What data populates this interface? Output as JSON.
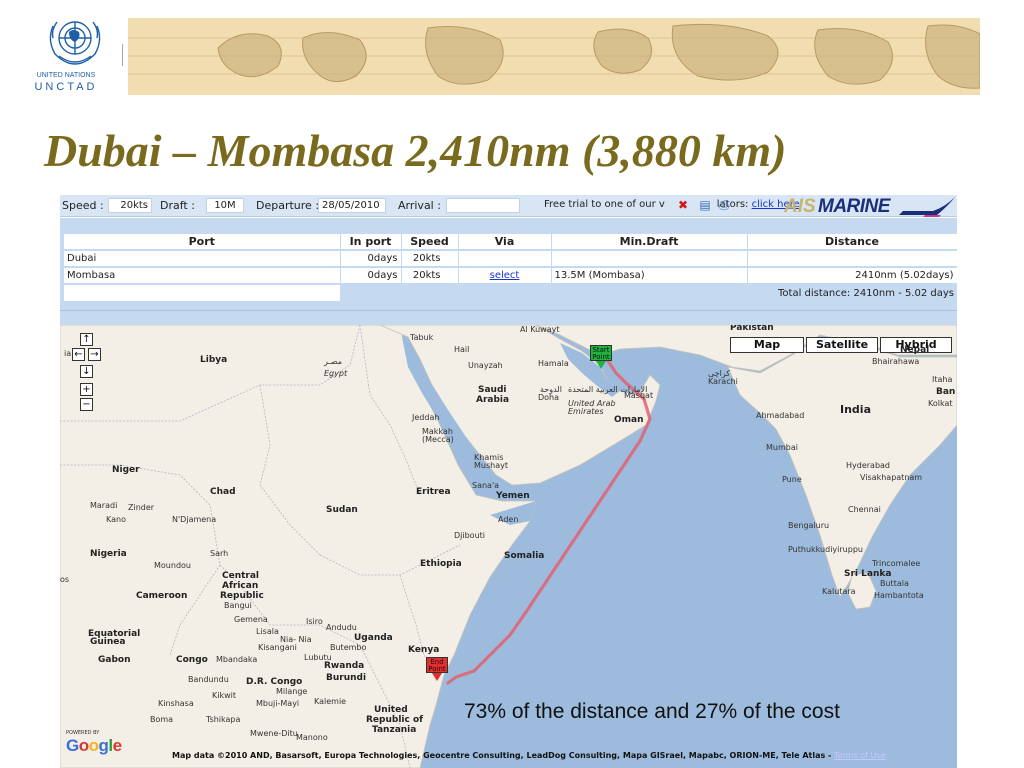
{
  "header": {
    "org_line1": "UNITED NATIONS",
    "org_line2": "UNCTAD"
  },
  "slide": {
    "title": "Dubai – Mombasa 2,410nm (3,880 km)"
  },
  "app": {
    "topbar": {
      "speed_label": "Speed :",
      "speed_value": "20",
      "speed_unit": "kts",
      "draft_label": "Draft :",
      "draft_value": "10M",
      "departure_label": "Departure :",
      "departure_value": "28/05/2010",
      "arrival_label": "Arrival :",
      "arrival_value": "",
      "promo_text": "Free trial to one of our v",
      "promo_text2": "lators:",
      "promo_link": "click here",
      "brand_prefix": "AIS",
      "brand_name": "MARINE"
    },
    "table": {
      "headers": [
        "Port",
        "In port",
        "Speed",
        "Via",
        "Min.Draft",
        "Distance"
      ],
      "rows": [
        {
          "port": "Dubai",
          "in_port_value": "0",
          "in_port_unit": "days",
          "speed_value": "20",
          "speed_unit": "kts",
          "via": "",
          "min_draft": "",
          "distance": ""
        },
        {
          "port": "Mombasa",
          "in_port_value": "0",
          "in_port_unit": "days",
          "speed_value": "20",
          "speed_unit": "kts",
          "via": "select",
          "min_draft": "13.5M (Mombasa)",
          "distance": "2410nm (5.02days)"
        }
      ],
      "total": "Total distance: 2410nm - 5.02 days"
    },
    "map": {
      "type_buttons": [
        "Map",
        "Satellite",
        "Hybrid"
      ],
      "nav_controls": [
        "↑",
        "←",
        "→",
        "↓",
        "+",
        "−"
      ],
      "start_marker": [
        "Start",
        "Point"
      ],
      "end_marker": [
        "End",
        "Point"
      ],
      "caption": "73% of the distance and 27% of the cost",
      "powered_by": "POWERED BY",
      "google": "Google",
      "attribution": "Map data ©2010 AND, Basarsoft, Europa Technologies, Geocentre Consulting, LeadDog Consulting, Mapa GISrael, Mapabc, ORION-ME, Tele Atlas -",
      "terms": "Terms of Use",
      "labels": {
        "libya": "Libya",
        "egypt_ar": "مصـر",
        "egypt": "Egypt",
        "tabuk": "Tabuk",
        "hail": "Hail",
        "unayzah": "Unayzah",
        "saudi": "Saudi",
        "arabia": "Arabia",
        "hamala": "Hamala",
        "doha": "Doha",
        "doha_ar": "الدوحة",
        "uae_ar": "الإمارات العربية المتحدة",
        "uae": "United Arab Emirates",
        "muscat": "Masqat",
        "oman": "Oman",
        "alikuwayt": "Al Kuwayt",
        "pakistan": "Pakistan",
        "karachi": "Karachi",
        "karachi_ar": "کراچی",
        "india": "India",
        "ahmadabad": "Ahmadabad",
        "mumbai": "Mumbai",
        "pune": "Pune",
        "hyderabad": "Hyderabad",
        "visakhapatnam": "Visakhapatnam",
        "chennai": "Chennai",
        "bengaluru": "Bengaluru",
        "sri_lanka": "Sri Lanka",
        "trincomalee": "Trincomalee",
        "kalutara": "Kalutara",
        "hambantota": "Hambantota",
        "batticaloa": "Buttala",
        "puthukkudiyiruppu": "Puthukkudiyiruppu",
        "nepal": "Nepal",
        "bhairahawa": "Bhairahawa",
        "kolkata": "Kolkat",
        "ban": "Ban",
        "itaha": "Itaha",
        "jeddah": "Jeddah",
        "makkah": "Makkah",
        "mecca": "(Mecca)",
        "khamis": "Khamis",
        "mushayt": "Mushayt",
        "sanaa": "Sana'a",
        "yemen": "Yemen",
        "aden": "Aden",
        "djibouti": "Djibouti",
        "somalia": "Somalia",
        "eritrea": "Eritrea",
        "ethiopia": "Ethiopia",
        "sudan": "Sudan",
        "chad": "Chad",
        "niger": "Niger",
        "nigeria": "Nigeria",
        "maradi": "Maradi",
        "zinder": "Zinder",
        "kano": "Kano",
        "ndjamena": "N'Djamena",
        "moundou": "Moundou",
        "sarh": "Sarh",
        "car1": "Central",
        "car2": "African",
        "car3": "Republic",
        "cameroon": "Cameroon",
        "bangui": "Bangui",
        "eq_guinea1": "Equatorial",
        "eq_guinea2": "Guinea",
        "gabon": "Gabon",
        "congo": "Congo",
        "mbandaka": "Mbandaka",
        "gemena": "Gemena",
        "lisala": "Lisala",
        "kisangani": "Kisangani",
        "drc": "D.R. Congo",
        "bandundu": "Bandundu",
        "kikwit": "Kikwit",
        "kinshasa": "Kinshasa",
        "tshikapa": "Tshikapa",
        "mbuji": "Mbuji-Mayi",
        "milange": "Milange",
        "kalemie": "Kalemie",
        "mwene": "Mwene-Ditu",
        "manono": "Manono",
        "boma": "Boma",
        "uganda": "Uganda",
        "kenya": "Kenya",
        "rwanda": "Rwanda",
        "burundi": "Burundi",
        "andudu": "Andudu",
        "nia": "Nia- Nia",
        "isiro": "Isiro",
        "butembo": "Butembo",
        "lubutu": "Lubutu",
        "tanzania1": "United",
        "tanzania2": "Republic of",
        "tanzania3": "Tanzania",
        "os": "os",
        "ia": "ia"
      }
    },
    "colors": {
      "route": "#e0616e",
      "sea": "#9dbcdd",
      "land": "#f3efe6",
      "table_band": "#c5d9f1",
      "title": "#7a6a1e",
      "start_marker": "#1db33e",
      "end_marker": "#e62e2e"
    }
  }
}
